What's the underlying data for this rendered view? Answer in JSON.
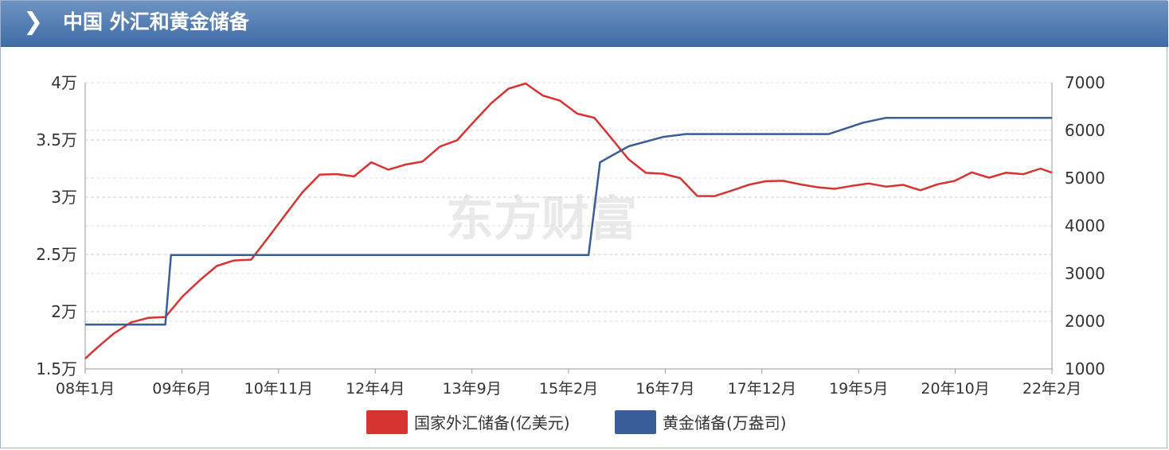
{
  "header": {
    "title": "中国 外汇和黄金储备"
  },
  "watermark": "东方财富",
  "colors": {
    "fx": "#d63331",
    "gold": "#3a5c97",
    "header_bg": "#4f7bb3"
  },
  "chart_data": {
    "type": "line",
    "title": "中国 外汇和黄金储备",
    "x_categories": [
      "08年1月",
      "09年6月",
      "10年11月",
      "12年4月",
      "13年9月",
      "15年2月",
      "16年7月",
      "17年12月",
      "19年5月",
      "20年10月",
      "22年2月"
    ],
    "x_range": [
      "2008-01",
      "2022-02"
    ],
    "y_left": {
      "ticks": [
        "1.5万",
        "2万",
        "2.5万",
        "3万",
        "3.5万",
        "4万"
      ],
      "range": [
        15000,
        40000
      ]
    },
    "y_right": {
      "ticks": [
        "1000",
        "2000",
        "3000",
        "4000",
        "5000",
        "6000",
        "7000"
      ],
      "range": [
        1000,
        7000
      ]
    },
    "grid": true,
    "legend_position": "bottom",
    "series": [
      {
        "name": "国家外汇储备(亿美元)",
        "axis": "left",
        "color": "#d63331",
        "points": [
          [
            "2008-01",
            15898
          ],
          [
            "2008-03",
            16822
          ],
          [
            "2008-06",
            18088
          ],
          [
            "2008-09",
            19056
          ],
          [
            "2008-12",
            19460
          ],
          [
            "2009-03",
            19537
          ],
          [
            "2009-06",
            21316
          ],
          [
            "2009-09",
            22726
          ],
          [
            "2009-12",
            23992
          ],
          [
            "2010-03",
            24471
          ],
          [
            "2010-06",
            24543
          ],
          [
            "2010-09",
            26483
          ],
          [
            "2010-12",
            28473
          ],
          [
            "2011-03",
            30447
          ],
          [
            "2011-06",
            31975
          ],
          [
            "2011-09",
            32017
          ],
          [
            "2011-12",
            31811
          ],
          [
            "2012-03",
            33050
          ],
          [
            "2012-06",
            32400
          ],
          [
            "2012-09",
            32850
          ],
          [
            "2012-12",
            33116
          ],
          [
            "2013-03",
            34426
          ],
          [
            "2013-06",
            34967
          ],
          [
            "2013-09",
            36627
          ],
          [
            "2013-12",
            38213
          ],
          [
            "2014-03",
            39481
          ],
          [
            "2014-06",
            39932
          ],
          [
            "2014-09",
            38877
          ],
          [
            "2014-12",
            38430
          ],
          [
            "2015-03",
            37300
          ],
          [
            "2015-06",
            36939
          ],
          [
            "2015-09",
            35141
          ],
          [
            "2015-12",
            33304
          ],
          [
            "2016-03",
            32125
          ],
          [
            "2016-06",
            32052
          ],
          [
            "2016-09",
            31664
          ],
          [
            "2016-12",
            30105
          ],
          [
            "2017-03",
            30091
          ],
          [
            "2017-06",
            30568
          ],
          [
            "2017-09",
            31085
          ],
          [
            "2017-12",
            31399
          ],
          [
            "2018-03",
            31428
          ],
          [
            "2018-06",
            31121
          ],
          [
            "2018-09",
            30870
          ],
          [
            "2018-12",
            30727
          ],
          [
            "2019-03",
            30988
          ],
          [
            "2019-06",
            31192
          ],
          [
            "2019-09",
            30924
          ],
          [
            "2019-12",
            31079
          ],
          [
            "2020-03",
            30606
          ],
          [
            "2020-06",
            31123
          ],
          [
            "2020-09",
            31426
          ],
          [
            "2020-12",
            32165
          ],
          [
            "2021-03",
            31700
          ],
          [
            "2021-06",
            32140
          ],
          [
            "2021-09",
            32006
          ],
          [
            "2021-12",
            32502
          ],
          [
            "2022-02",
            32138
          ]
        ]
      },
      {
        "name": "黄金储备(万盎司)",
        "axis": "right",
        "color": "#3a5c97",
        "points": [
          [
            "2008-01",
            1929
          ],
          [
            "2009-03",
            1929
          ],
          [
            "2009-04",
            3389
          ],
          [
            "2015-05",
            3389
          ],
          [
            "2015-07",
            5332
          ],
          [
            "2015-12",
            5666
          ],
          [
            "2016-06",
            5862
          ],
          [
            "2016-10",
            5924
          ],
          [
            "2018-11",
            5924
          ],
          [
            "2019-05",
            6161
          ],
          [
            "2019-09",
            6264
          ],
          [
            "2022-02",
            6264
          ]
        ]
      }
    ]
  }
}
